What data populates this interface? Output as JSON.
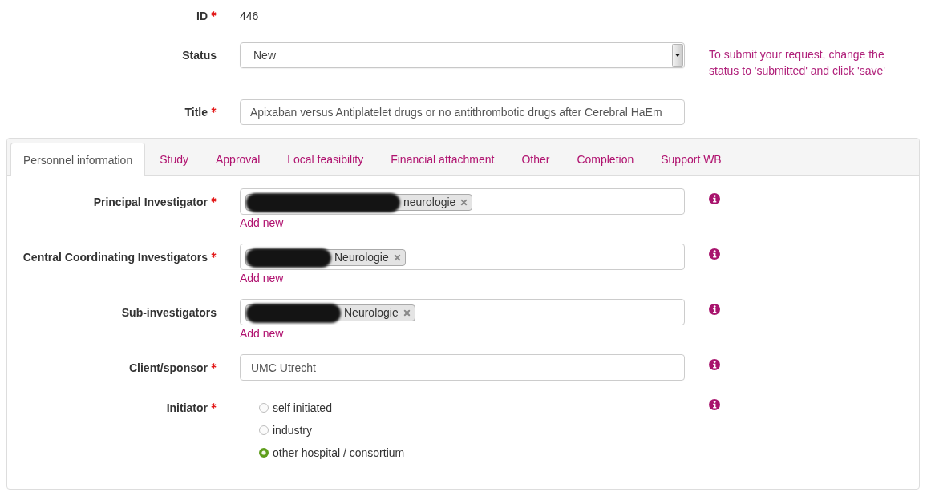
{
  "fields": [
    {
      "kind": "text",
      "label": "ID",
      "required": true,
      "value": "446"
    },
    {
      "kind": "select",
      "label": "Status",
      "required": false,
      "value": "New",
      "help": "To submit your request, change the status to 'submitted' and click 'save'"
    },
    {
      "kind": "input",
      "label": "Title",
      "required": true,
      "value": "Apixaban versus Antiplatelet drugs or no antithrombotic drugs after Cerebral HaEm"
    }
  ],
  "tabs": [
    {
      "label": "Personnel information",
      "selected": true
    },
    {
      "label": "Study",
      "selected": false
    },
    {
      "label": "Approval",
      "selected": false
    },
    {
      "label": "Local feasibility",
      "selected": false
    },
    {
      "label": "Financial attachment",
      "selected": false
    },
    {
      "label": "Other",
      "selected": false
    },
    {
      "label": "Completion",
      "selected": false
    },
    {
      "label": "Support WB",
      "selected": false
    }
  ],
  "panel_fields": [
    {
      "kind": "tags",
      "label": "Principal Investigator",
      "required": true,
      "tags": [
        {
          "text": "neurologie",
          "redacted": true
        }
      ],
      "link": "Add new"
    },
    {
      "kind": "tags",
      "label": "Central Coordinating Investigators",
      "required": true,
      "tags": [
        {
          "text": "Neurologie",
          "redacted": true
        }
      ],
      "link": "Add new"
    },
    {
      "kind": "tags",
      "label": "Sub-investigators",
      "required": false,
      "tags": [
        {
          "text": "Neurologie",
          "redacted": true
        }
      ],
      "link": "Add new"
    },
    {
      "kind": "input",
      "label": "Client/sponsor",
      "required": true,
      "value": "UMC Utrecht"
    },
    {
      "kind": "radio",
      "label": "Initiator",
      "required": true,
      "options": [
        {
          "label": "self initiated",
          "selected": false
        },
        {
          "label": "industry",
          "selected": false
        },
        {
          "label": "other hospital / consortium",
          "selected": true
        }
      ]
    }
  ]
}
